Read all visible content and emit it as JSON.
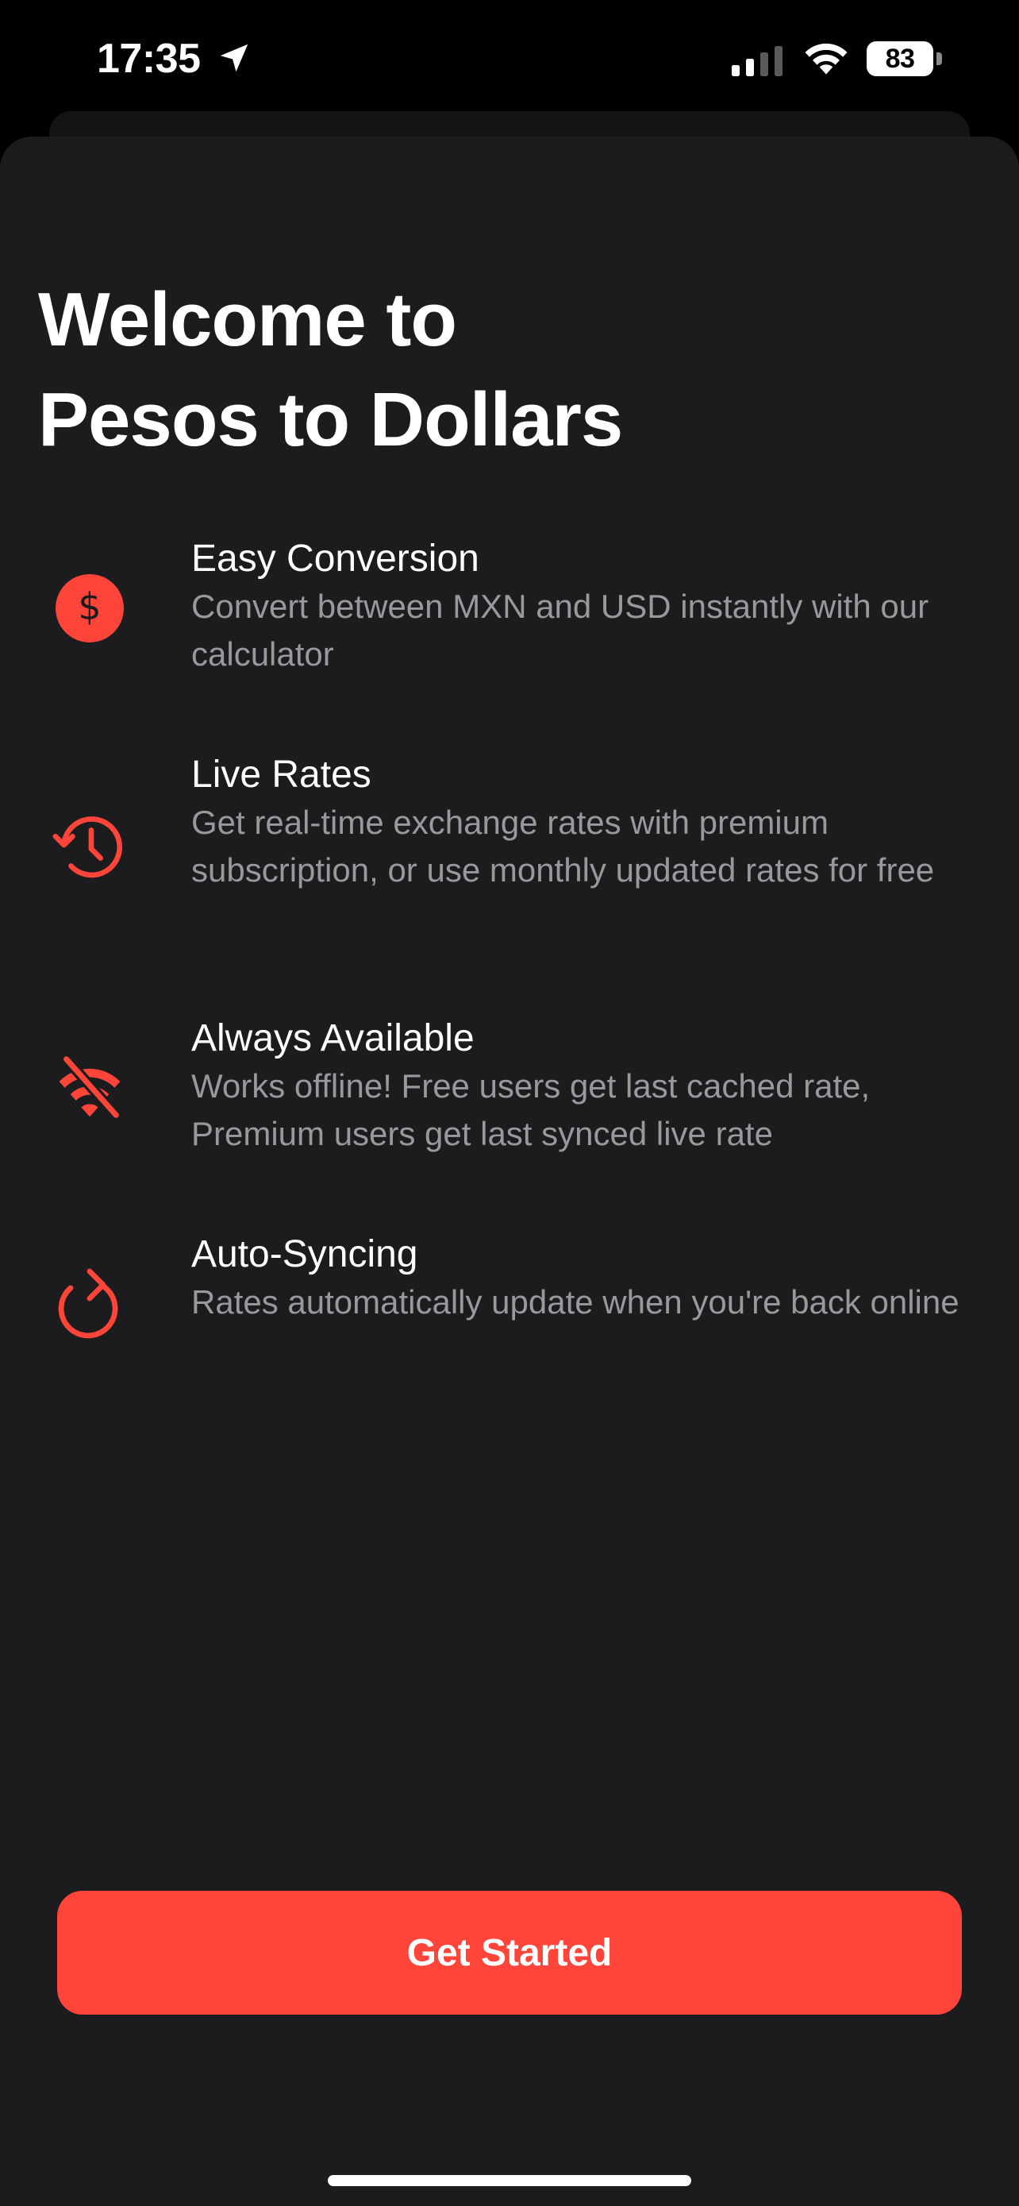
{
  "status_bar": {
    "time": "17:35",
    "battery": "83"
  },
  "onboarding": {
    "title_line1": "Welcome to",
    "title_line2": "Pesos to Dollars",
    "features": [
      {
        "icon": "dollar-circle-icon",
        "title": "Easy Conversion",
        "description": "Convert between MXN and USD instantly with our calculator"
      },
      {
        "icon": "clock-history-icon",
        "title": "Live Rates",
        "description": "Get real-time exchange rates with premium subscription, or use monthly updated rates for free"
      },
      {
        "icon": "wifi-slash-icon",
        "title": "Always Available",
        "description": "Works offline! Free users get last cached rate, Premium users get last synced live rate"
      },
      {
        "icon": "refresh-icon",
        "title": "Auto-Syncing",
        "description": "Rates automatically update when you're back online"
      }
    ],
    "cta_label": "Get Started"
  },
  "colors": {
    "accent": "#ff453a",
    "background": "#1c1c1e",
    "secondary_text": "#98989d"
  }
}
